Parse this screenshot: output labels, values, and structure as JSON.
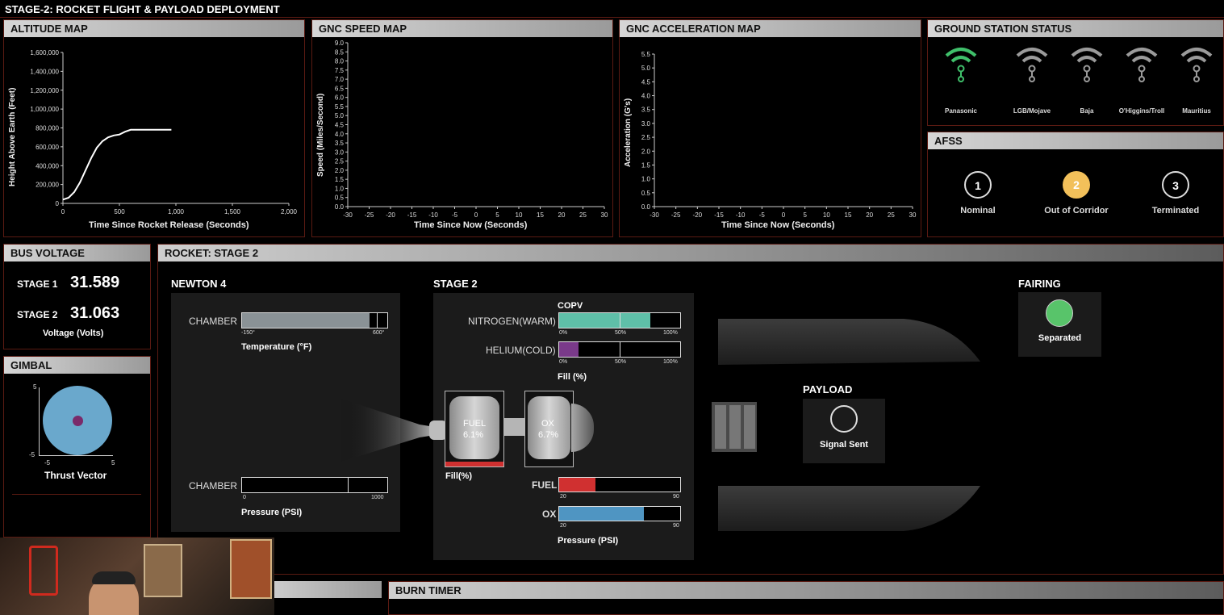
{
  "page_title": "STAGE-2: ROCKET FLIGHT & PAYLOAD DEPLOYMENT",
  "altitude_map": {
    "title": "ALTITUDE MAP",
    "ylabel": "Height Above Earth (Feet)",
    "xlabel": "Time Since Rocket Release (Seconds)",
    "yticks": [
      "1,600,000",
      "1,400,000",
      "1,200,000",
      "1,000,000",
      "800,000",
      "600,000",
      "400,000",
      "200,000",
      "0"
    ],
    "xticks": [
      "0",
      "500",
      "1,000",
      "1,500",
      "2,000"
    ]
  },
  "speed_map": {
    "title": "GNC SPEED MAP",
    "ylabel": "Speed (Miles/Second)",
    "xlabel": "Time Since Now (Seconds)",
    "yticks": [
      "9.0",
      "8.5",
      "8.0",
      "7.5",
      "7.0",
      "6.5",
      "6.0",
      "5.5",
      "5.0",
      "4.5",
      "4.0",
      "3.5",
      "3.0",
      "2.5",
      "2.0",
      "1.5",
      "1.0",
      "0.5",
      "0.0"
    ],
    "xticks": [
      "-30",
      "-25",
      "-20",
      "-15",
      "-10",
      "-5",
      "0",
      "5",
      "10",
      "15",
      "20",
      "25",
      "30"
    ]
  },
  "accel_map": {
    "title": "GNC ACCELERATION MAP",
    "ylabel": "Acceleration (G's)",
    "xlabel": "Time Since Now (Seconds)",
    "yticks": [
      "5.5",
      "5.0",
      "4.5",
      "4.0",
      "3.5",
      "3.0",
      "2.5",
      "2.0",
      "1.5",
      "1.0",
      "0.5",
      "0.0"
    ],
    "xticks": [
      "-30",
      "-25",
      "-20",
      "-15",
      "-10",
      "-5",
      "0",
      "5",
      "10",
      "15",
      "20",
      "25",
      "30"
    ]
  },
  "chart_data": [
    {
      "type": "line",
      "title": "ALTITUDE MAP",
      "xlabel": "Time Since Rocket Release (Seconds)",
      "ylabel": "Height Above Earth (Feet)",
      "xlim": [
        0,
        2000
      ],
      "ylim": [
        0,
        1700000
      ],
      "series": [
        {
          "x": [
            0,
            50,
            100,
            150,
            200,
            250,
            300,
            350,
            400,
            450,
            500,
            550,
            600,
            650,
            700,
            800,
            900,
            960
          ],
          "values": [
            40000,
            60000,
            120000,
            220000,
            350000,
            480000,
            590000,
            660000,
            700000,
            720000,
            730000,
            760000,
            780000,
            780000,
            780000,
            780000,
            780000,
            780000
          ]
        }
      ]
    },
    {
      "type": "line",
      "title": "GNC SPEED MAP",
      "xlabel": "Time Since Now (Seconds)",
      "ylabel": "Speed (Miles/Second)",
      "xlim": [
        -30,
        30
      ],
      "ylim": [
        0,
        9
      ],
      "series": []
    },
    {
      "type": "line",
      "title": "GNC ACCELERATION MAP",
      "xlabel": "Time Since Now (Seconds)",
      "ylabel": "Acceleration (G's)",
      "xlim": [
        -30,
        30
      ],
      "ylim": [
        0,
        5.5
      ],
      "series": []
    }
  ],
  "ground_station": {
    "title": "GROUND STATION STATUS",
    "stations": [
      {
        "name": "Panasonic",
        "active": true
      },
      {
        "name": "LGB/Mojave",
        "active": false
      },
      {
        "name": "Baja",
        "active": false
      },
      {
        "name": "O'Higgins/Troll",
        "active": false
      },
      {
        "name": "Mauritius",
        "active": false
      }
    ],
    "active_color": "#3fbf6a",
    "inactive_color": "#9a9a9a"
  },
  "afss": {
    "title": "AFSS",
    "states": [
      {
        "num": "1",
        "label": "Nominal",
        "active": false
      },
      {
        "num": "2",
        "label": "Out of Corridor",
        "active": true
      },
      {
        "num": "3",
        "label": "Terminated",
        "active": false
      }
    ],
    "active_color": "#f2c05a"
  },
  "bus_voltage": {
    "title": "BUS VOLTAGE",
    "stage1_label": "STAGE 1",
    "stage1_value": "31.589",
    "stage2_label": "STAGE 2",
    "stage2_value": "31.063",
    "unit_label": "Voltage (Volts)"
  },
  "gimbal": {
    "title": "GIMBAL",
    "label": "Thrust Vector",
    "tick_top": "5",
    "tick_bottom": "-5",
    "tick_left": "-5",
    "tick_right": "5",
    "disc_color": "#6aa8cc",
    "dot_color": "#7a2a6a"
  },
  "rocket": {
    "title": "ROCKET: STAGE 2",
    "newton": {
      "title": "NEWTON 4",
      "temp_label": "CHAMBER",
      "temp_min": "-150°",
      "temp_max": "600°",
      "temp_axis": "Temperature (°F)",
      "temp_fill": 0.88,
      "press_label": "CHAMBER",
      "press_min": "0",
      "press_max": "1000",
      "press_axis": "Pressure (PSI)",
      "press_fill": 0.0
    },
    "stage2": {
      "title": "STAGE 2",
      "copv_label": "COPV",
      "nitrogen_label": "NITROGEN(WARM)",
      "nitrogen_fill": 0.75,
      "helium_label": "HELIUM(COLD)",
      "helium_fill": 0.16,
      "pct_0": "0%",
      "pct_50": "50%",
      "pct_100": "100%",
      "fill_axis": "Fill (%)",
      "fuel_tank_label": "FUEL",
      "fuel_tank_value": "6.1%",
      "ox_tank_label": "OX",
      "ox_tank_value": "6.7%",
      "tank_fill_label": "Fill(%)",
      "fuel_label": "FUEL",
      "fuel_fill": 0.3,
      "ox_label": "OX",
      "ox_fill": 0.7,
      "press_min": "20",
      "press_max": "90",
      "press_axis": "Pressure (PSI)",
      "nitrogen_color": "#5fbfa8",
      "helium_color": "#7a3a8a",
      "fuel_color": "#d03030",
      "ox_color": "#4f95c2"
    },
    "payload": {
      "title": "PAYLOAD",
      "status": "Signal Sent"
    },
    "fairing": {
      "title": "FAIRING",
      "status": "Separated",
      "color": "#58c46a"
    }
  },
  "burn_timer": {
    "title": "BURN TIMER"
  }
}
